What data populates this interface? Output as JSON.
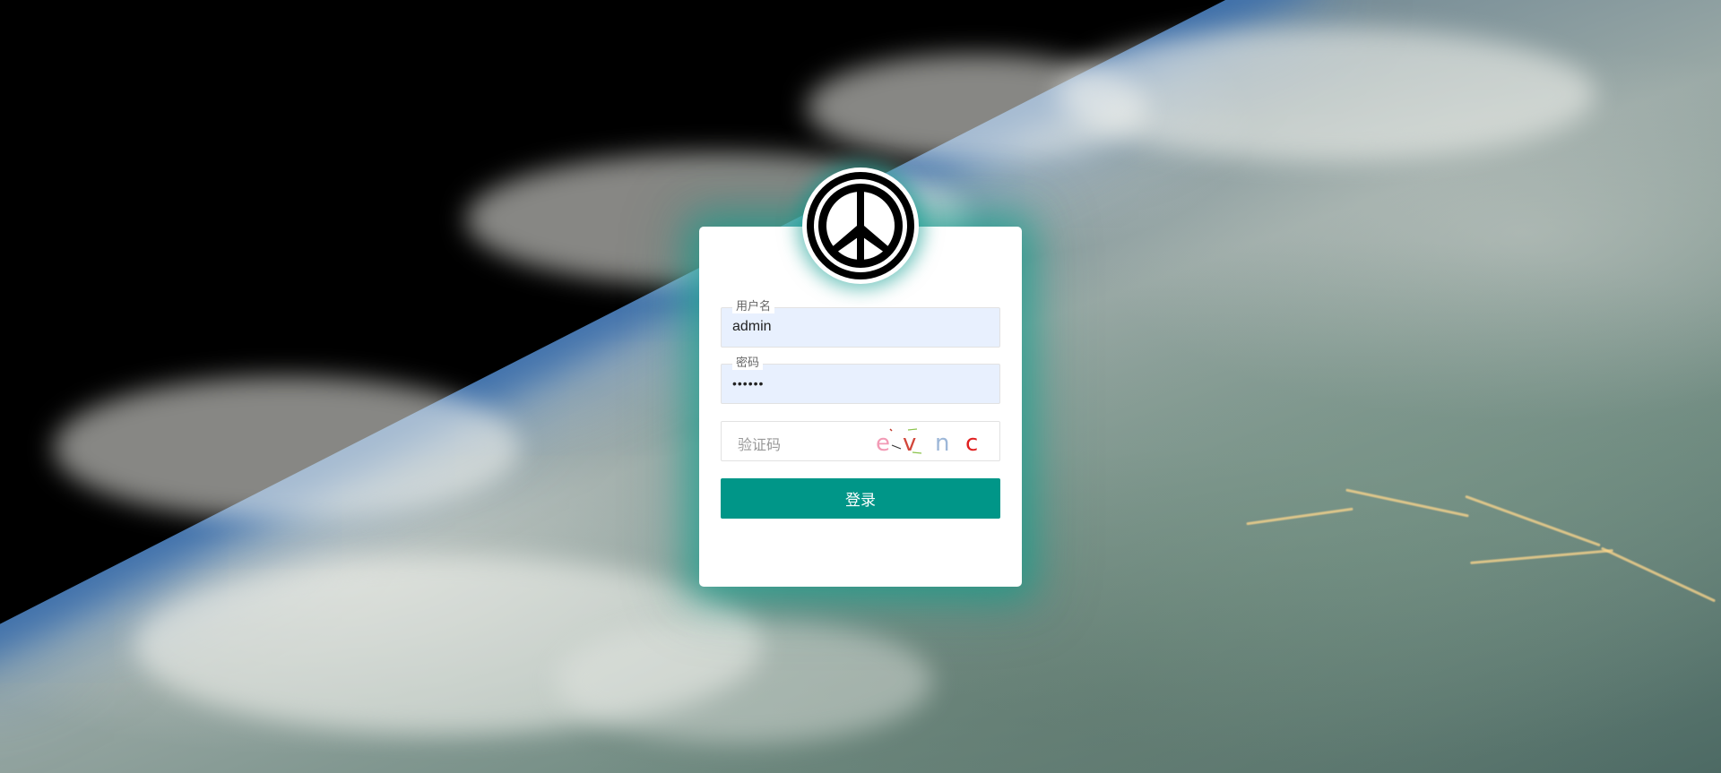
{
  "login": {
    "username": {
      "label": "用户名",
      "value": "admin"
    },
    "password": {
      "label": "密码",
      "masked_value": "••••••"
    },
    "captcha": {
      "placeholder": "验证码",
      "chars": [
        "e",
        "v",
        "n",
        "c"
      ],
      "colors": [
        "#f29ab5",
        "#d2463a",
        "#9db7d8",
        "#e02020"
      ]
    },
    "submit_label": "登录"
  },
  "colors": {
    "accent": "#009688",
    "field_bg": "#e8f0fe"
  },
  "icons": {
    "logo": "peace-symbol-icon"
  }
}
